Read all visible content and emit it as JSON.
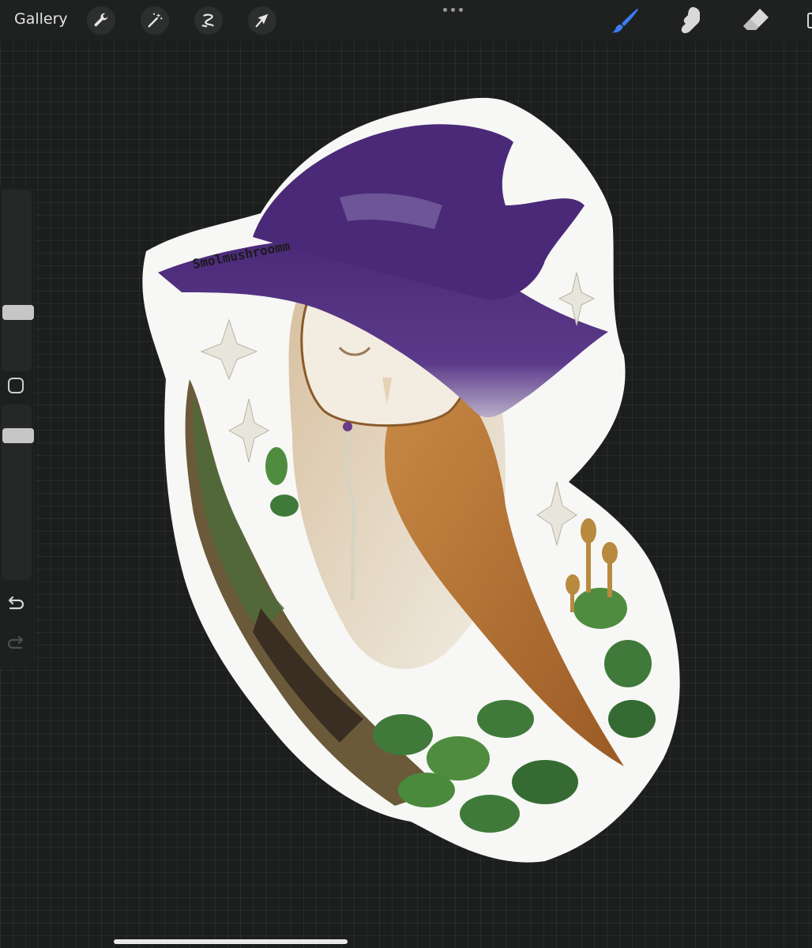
{
  "toolbar": {
    "gallery_label": "Gallery",
    "left_tools": [
      "wrench-icon",
      "magic-wand-icon",
      "selection-icon",
      "transform-arrow-icon"
    ],
    "right_tools": [
      "brush-icon",
      "smudge-icon",
      "eraser-icon"
    ],
    "active_tool": "brush-icon",
    "accent_color": "#3b7cf6"
  },
  "sidebar": {
    "brush_size_level": 0.31,
    "opacity_level": 0.85,
    "undo_icon": "undo-icon",
    "redo_icon": "redo-icon"
  },
  "canvas": {
    "background_color": "#1c1e1e",
    "artwork": {
      "signature": "Smolmushroomm",
      "hat_color": "#4a2a78",
      "owl_face_color": "#f3ece0",
      "feather_color": "#b57436",
      "leaf_color": "#3f7a3a",
      "border_color": "#f7f7f5"
    }
  }
}
